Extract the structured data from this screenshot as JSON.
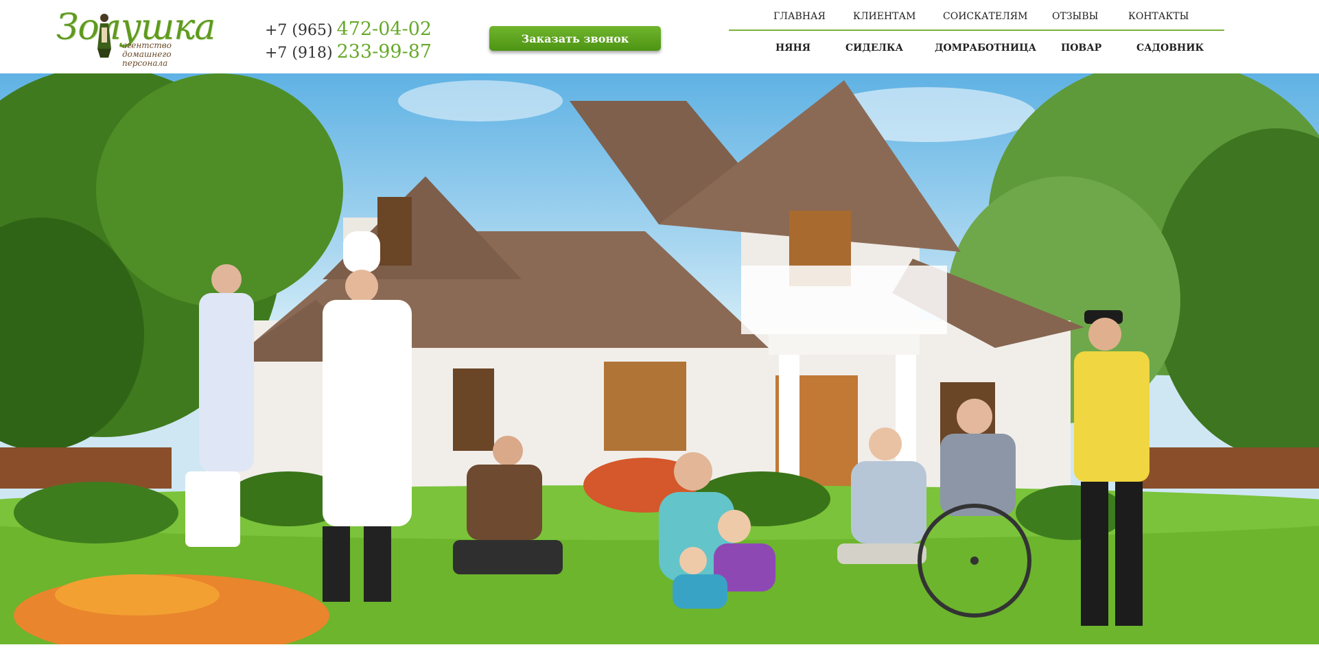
{
  "brand": {
    "logo_name": "Золушка",
    "logo_subtitle": "агентство домашнего персонала"
  },
  "phones": [
    {
      "code": "+7 (965)",
      "number": "472-04-02"
    },
    {
      "code": "+7 (918)",
      "number": "233-99-87"
    }
  ],
  "call_button": "Заказать звонок",
  "nav_top": [
    "ГЛАВНАЯ",
    "КЛИЕНТАМ",
    "СОИСКАТЕЛЯМ",
    "ОТЗЫВЫ",
    "КОНТАКТЫ"
  ],
  "nav_bottom": [
    "НЯНЯ",
    "СИДЕЛКА",
    "ДОМРАБОТНИЦА",
    "ПОВАР",
    "САДОВНИК"
  ],
  "colors": {
    "accent": "#66a92a",
    "button": "#5aa21c",
    "nav_line": "#7bb33a",
    "logo_brown": "#6b4a2b"
  }
}
